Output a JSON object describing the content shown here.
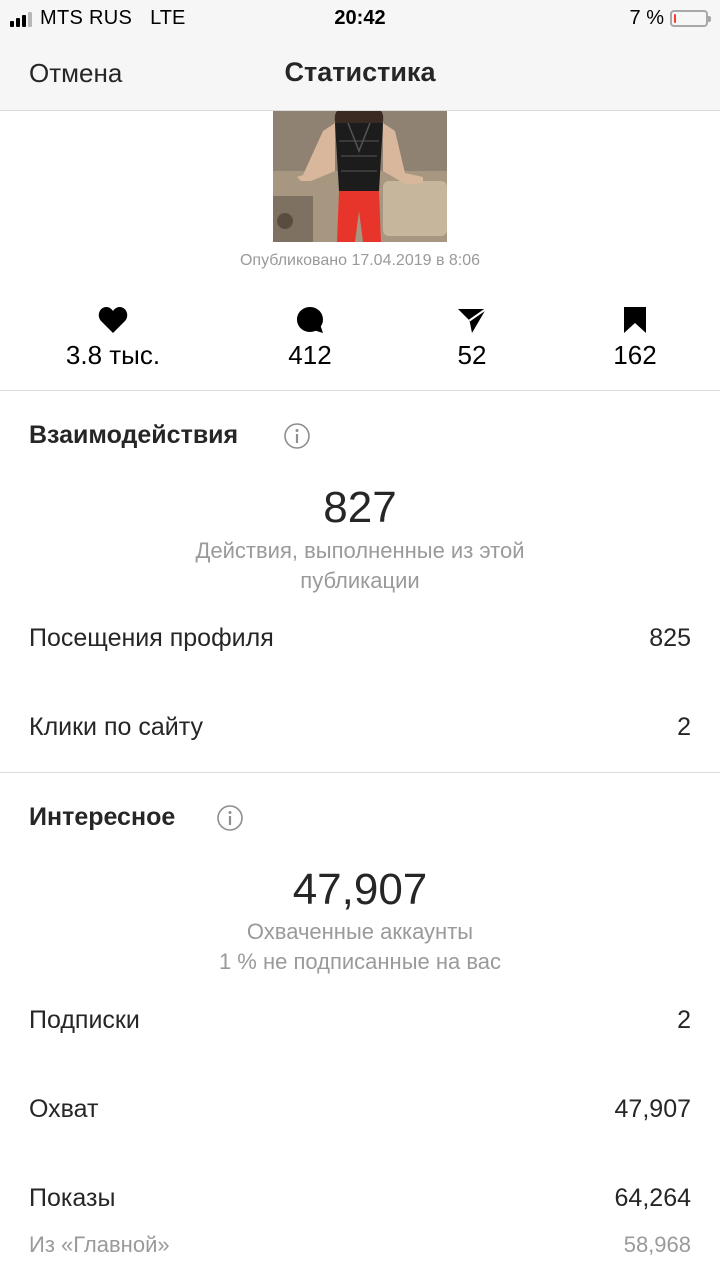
{
  "status_bar": {
    "carrier": "MTS RUS",
    "network": "LTE",
    "time": "20:42",
    "battery_percent": "7 %",
    "battery_level": 0.07
  },
  "nav": {
    "cancel_label": "Отмена",
    "title": "Статистика"
  },
  "post": {
    "published": "Опубликовано 17.04.2019 в 8:06"
  },
  "counts": {
    "likes": "3.8 тыс.",
    "comments": "412",
    "shares": "52",
    "saves": "162"
  },
  "interactions": {
    "title": "Взаимодействия",
    "total": "827",
    "caption": "Действия, выполненные из этой публикации",
    "rows": [
      {
        "label": "Посещения профиля",
        "value": "825"
      },
      {
        "label": "Клики по сайту",
        "value": "2"
      }
    ]
  },
  "discovery": {
    "title": "Интересное",
    "total": "47,907",
    "caption_line1": "Охваченные аккаунты",
    "caption_line2": "1 % не подписанные на вас",
    "rows": [
      {
        "label": "Подписки",
        "value": "2"
      },
      {
        "label": "Охват",
        "value": "47,907"
      },
      {
        "label": "Показы",
        "value": "64,264"
      }
    ],
    "sub_rows": [
      {
        "label": "Из «Главной»",
        "value": "58,968"
      }
    ]
  },
  "colors": {
    "text": "#262626",
    "muted": "#9a9a9a",
    "divider": "#dcdcdc",
    "battery_low": "#ff3b30",
    "pants_red": "#e8352b"
  }
}
